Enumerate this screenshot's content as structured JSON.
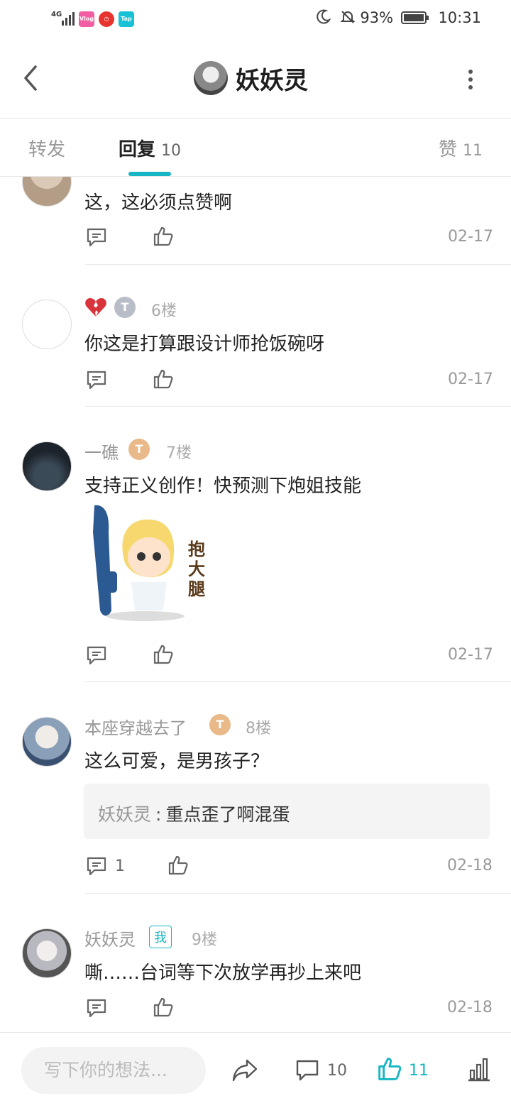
{
  "status_bar": {
    "network": "4G",
    "battery": "93%",
    "time": "10:31",
    "app_icons": [
      "vlog-icon",
      "timer-icon",
      "taptap-icon"
    ]
  },
  "header": {
    "title": "妖妖灵"
  },
  "tabs": [
    {
      "label": "转发",
      "count": ""
    },
    {
      "label": "回复",
      "count": "10"
    },
    {
      "label": "赞",
      "count": "11"
    }
  ],
  "comments": [
    {
      "text": "这，这必须点赞啊",
      "date": "02-17"
    },
    {
      "name": "",
      "level": "3",
      "floor": "6楼",
      "text": "你这是打算跟设计师抢饭碗呀",
      "date": "02-17"
    },
    {
      "name": "一礁",
      "level": "4",
      "floor": "7楼",
      "text": "支持正义创作！快预测下炮姐技能",
      "sticker_text": "抱大腿",
      "date": "02-17"
    },
    {
      "name": "本座穿越去了",
      "level": "5",
      "floor": "8楼",
      "text": "这么可爱，是男孩子？",
      "reply": {
        "author": "妖妖灵",
        "sep": ":",
        "text": "重点歪了啊混蛋"
      },
      "reply_count": "1",
      "date": "02-18"
    },
    {
      "name": "妖妖灵",
      "me_badge": "我",
      "floor": "9楼",
      "text": "嘶……台词等下次放学再抄上来吧",
      "date": "02-18"
    }
  ],
  "bottom_bar": {
    "placeholder": "写下你的想法...",
    "comment_count": "10",
    "like_count": "11"
  },
  "colors": {
    "accent": "#16b6c4",
    "text": "#222222",
    "muted": "#999999"
  }
}
